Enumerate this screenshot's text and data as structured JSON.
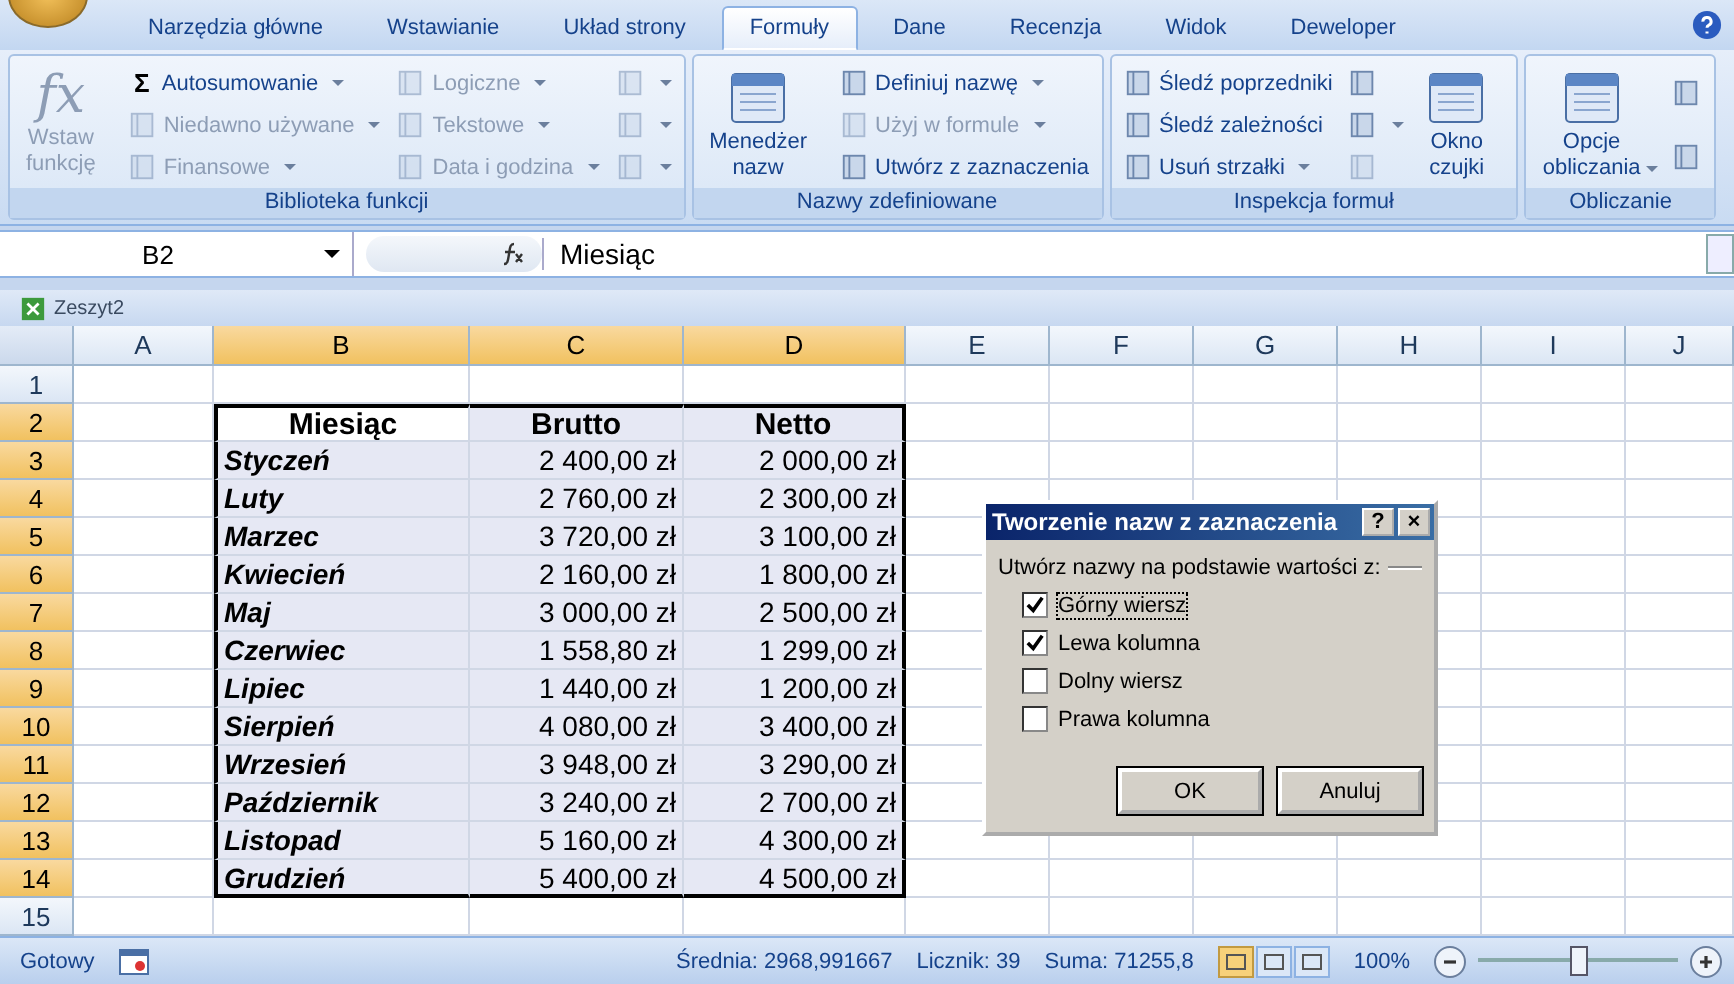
{
  "tabs": [
    {
      "label": "Narzędzia główne",
      "selected": false
    },
    {
      "label": "Wstawianie",
      "selected": false
    },
    {
      "label": "Układ strony",
      "selected": false
    },
    {
      "label": "Formuły",
      "selected": true
    },
    {
      "label": "Dane",
      "selected": false
    },
    {
      "label": "Recenzja",
      "selected": false
    },
    {
      "label": "Widok",
      "selected": false
    },
    {
      "label": "Deweloper",
      "selected": false
    }
  ],
  "ribbon": [
    {
      "title": "Biblioteka funkcji",
      "columns": [
        [
          {
            "kind": "large",
            "glyph": "fx",
            "label": "Wstaw funkcję",
            "disabled": true,
            "dropdown": false
          }
        ],
        [
          {
            "kind": "small",
            "glyph": "Σ",
            "label": "Autosumowanie",
            "disabled": false,
            "dropdown": true
          },
          {
            "kind": "small",
            "label": "Niedawno używane",
            "disabled": true,
            "dropdown": true
          },
          {
            "kind": "small",
            "label": "Finansowe",
            "disabled": true,
            "dropdown": true
          }
        ],
        [
          {
            "kind": "small",
            "label": "Logiczne",
            "disabled": true,
            "dropdown": true
          },
          {
            "kind": "small",
            "label": "Tekstowe",
            "disabled": true,
            "dropdown": true
          },
          {
            "kind": "small",
            "label": "Data i godzina",
            "disabled": true,
            "dropdown": true
          }
        ],
        [
          {
            "kind": "icon",
            "disabled": true,
            "dropdown": true
          },
          {
            "kind": "icon",
            "disabled": true,
            "dropdown": true
          },
          {
            "kind": "icon",
            "disabled": true,
            "dropdown": true
          }
        ]
      ]
    },
    {
      "title": "Nazwy zdefiniowane",
      "columns": [
        [
          {
            "kind": "large",
            "label": "Menedżer nazw",
            "disabled": false,
            "dropdown": false
          }
        ],
        [
          {
            "kind": "small",
            "label": "Definiuj nazwę",
            "disabled": false,
            "dropdown": true
          },
          {
            "kind": "small",
            "label": "Użyj w formule",
            "disabled": true,
            "dropdown": true
          },
          {
            "kind": "small",
            "label": "Utwórz z zaznaczenia",
            "disabled": false,
            "dropdown": false
          }
        ]
      ]
    },
    {
      "title": "Inspekcja formuł",
      "columns": [
        [
          {
            "kind": "small",
            "label": "Śledź poprzedniki",
            "disabled": false,
            "dropdown": false
          },
          {
            "kind": "small",
            "label": "Śledź zależności",
            "disabled": false,
            "dropdown": false
          },
          {
            "kind": "small",
            "label": "Usuń strzałki",
            "disabled": false,
            "dropdown": true
          }
        ],
        [
          {
            "kind": "icon",
            "disabled": false,
            "dropdown": false
          },
          {
            "kind": "icon",
            "disabled": false,
            "dropdown": true
          },
          {
            "kind": "icon",
            "disabled": true,
            "dropdown": false
          }
        ],
        [
          {
            "kind": "large",
            "label": "Okno czujki",
            "disabled": false,
            "dropdown": false
          }
        ]
      ]
    },
    {
      "title": "Obliczanie",
      "columns": [
        [
          {
            "kind": "large",
            "label": "Opcje obliczania",
            "disabled": false,
            "dropdown": true
          }
        ],
        [
          {
            "kind": "icon",
            "disabled": false,
            "dropdown": false
          },
          {
            "kind": "icon",
            "disabled": false,
            "dropdown": false
          }
        ]
      ]
    }
  ],
  "formula_bar": {
    "name_box": "B2",
    "value": "Miesiąc"
  },
  "workbook": {
    "title": "Zeszyt2"
  },
  "sheet": {
    "columns": [
      {
        "label": "A",
        "selected": false
      },
      {
        "label": "B",
        "selected": true
      },
      {
        "label": "C",
        "selected": true
      },
      {
        "label": "D",
        "selected": true
      },
      {
        "label": "E",
        "selected": false
      },
      {
        "label": "F",
        "selected": false
      },
      {
        "label": "G",
        "selected": false
      },
      {
        "label": "H",
        "selected": false
      },
      {
        "label": "I",
        "selected": false
      },
      {
        "label": "J",
        "selected": false
      }
    ],
    "rows": [
      {
        "label": "1",
        "selected": false
      },
      {
        "label": "2",
        "selected": true,
        "kind": "header",
        "values": [
          "Miesiąc",
          "Brutto",
          "Netto"
        ]
      },
      {
        "label": "3",
        "selected": true,
        "kind": "data",
        "values": [
          "Styczeń",
          "2 400,00 zł",
          "2 000,00 zł"
        ]
      },
      {
        "label": "4",
        "selected": true,
        "kind": "data",
        "values": [
          "Luty",
          "2 760,00 zł",
          "2 300,00 zł"
        ]
      },
      {
        "label": "5",
        "selected": true,
        "kind": "data",
        "values": [
          "Marzec",
          "3 720,00 zł",
          "3 100,00 zł"
        ]
      },
      {
        "label": "6",
        "selected": true,
        "kind": "data",
        "values": [
          "Kwiecień",
          "2 160,00 zł",
          "1 800,00 zł"
        ]
      },
      {
        "label": "7",
        "selected": true,
        "kind": "data",
        "values": [
          "Maj",
          "3 000,00 zł",
          "2 500,00 zł"
        ]
      },
      {
        "label": "8",
        "selected": true,
        "kind": "data",
        "values": [
          "Czerwiec",
          "1 558,80 zł",
          "1 299,00 zł"
        ]
      },
      {
        "label": "9",
        "selected": true,
        "kind": "data",
        "values": [
          "Lipiec",
          "1 440,00 zł",
          "1 200,00 zł"
        ]
      },
      {
        "label": "10",
        "selected": true,
        "kind": "data",
        "values": [
          "Sierpień",
          "4 080,00 zł",
          "3 400,00 zł"
        ]
      },
      {
        "label": "11",
        "selected": true,
        "kind": "data",
        "values": [
          "Wrzesień",
          "3 948,00 zł",
          "3 290,00 zł"
        ]
      },
      {
        "label": "12",
        "selected": true,
        "kind": "data",
        "values": [
          "Październik",
          "3 240,00 zł",
          "2 700,00 zł"
        ]
      },
      {
        "label": "13",
        "selected": true,
        "kind": "data",
        "values": [
          "Listopad",
          "5 160,00 zł",
          "4 300,00 zł"
        ]
      },
      {
        "label": "14",
        "selected": true,
        "kind": "data",
        "values": [
          "Grudzień",
          "5 400,00 zł",
          "4 500,00 zł"
        ]
      },
      {
        "label": "15",
        "selected": false
      }
    ]
  },
  "dialog": {
    "title": "Tworzenie nazw z zaznaczenia",
    "help": "?",
    "close": "×",
    "group_label": "Utwórz nazwy na podstawie wartości z:",
    "options": [
      {
        "label": "Górny wiersz",
        "checked": true
      },
      {
        "label": "Lewa kolumna",
        "checked": true
      },
      {
        "label": "Dolny wiersz",
        "checked": false
      },
      {
        "label": "Prawa kolumna",
        "checked": false
      }
    ],
    "buttons": [
      "OK",
      "Anuluj"
    ]
  },
  "status_bar": {
    "status": "Gotowy",
    "average": "Średnia: 2968,991667",
    "count": "Licznik: 39",
    "sum": "Suma: 71255,8",
    "views": [
      {
        "selected": true
      },
      {
        "selected": false
      },
      {
        "selected": false
      }
    ],
    "zoom": "100%",
    "zoom_level": {
      "level": 0.5
    }
  }
}
